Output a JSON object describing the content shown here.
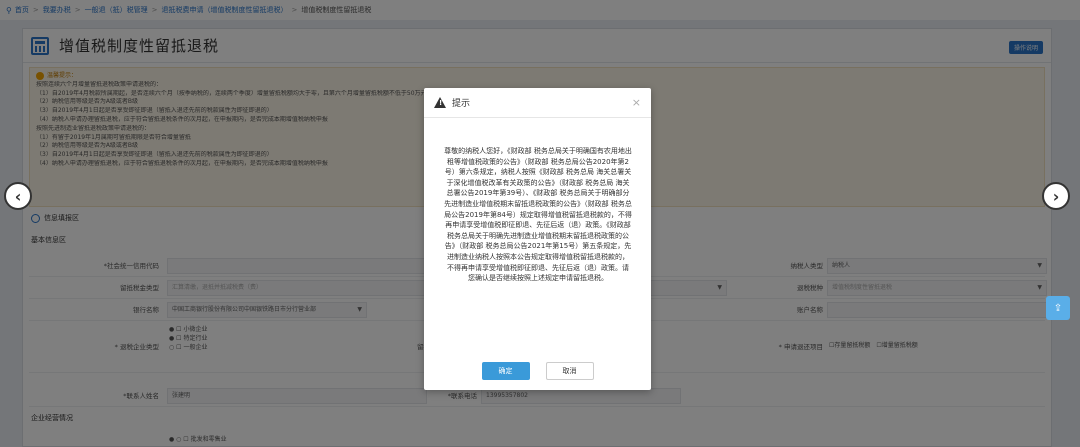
{
  "breadcrumb": {
    "items": [
      "首页",
      "我要办税",
      "一般退（抵）税管理",
      "退抵税费申请（增值税制度性留抵退税）",
      "增值税制度性留抵退税"
    ]
  },
  "panel": {
    "title": "增值税制度性留抵退税",
    "op_guide": "操作说明"
  },
  "tips": {
    "head": "温馨提示：",
    "lines": [
      "按照连续六个月增量留抵退税政策申请退税的：",
      "（1）自2019年4月税款所属期起，是否连续六个月（按季纳税的，连续两个季度）增量留抵税额均大于零，且第六个月增量留抵税额不低于50万元；是否符合纳税信用等级为A级或者B级；增量留抵税额是否符合以上条件",
      "（2）纳税信用等级是否为A级或者B级",
      "（3）自2019年4月1日起是否享受即征即退（留抵入退还先前的税款属性为即征即退的）",
      "（4）纳税人申请办理留抵退税，应于符合留抵退税条件的次月起，在申报期内，是否完成本期增值税纳税申报",
      "按照先进制造业留抵退税政策申请退税的：",
      "（1）有留于2019年1月属期可留抵期限是否符合增量留抵",
      "（2）纳税信用等级是否为A级或者B级",
      "（3）自2019年4月1日起是否享受即征即退（留抵入退还先前的税款属性为即征即退的）",
      "（4）纳税人申请办理留抵退税，应于符合留抵退税条件的次月起，在申报期内，是否完成本期增值税纳税申报"
    ]
  },
  "sections": {
    "info_title": "信息填报区",
    "basic_title": "基本信息区",
    "ops_title": "企业经营情况"
  },
  "form": {
    "credit_code_label": "*社会统一信用代码",
    "refund_type_label": "留抵税金类型",
    "refund_type_value": "汇算清缴，退抵并抵减税费（费）",
    "bank_label": "银行名称",
    "bank_value": "中国工商银行股份有限公司中国银铁路日市分行营业部",
    "enterprise_type_label": "* 退税企业类型",
    "enterprise_type_opts": [
      "小微企业",
      "特定行业",
      "一般企业"
    ],
    "middle_label": "留抵退税",
    "contact_label": "*联系人姓名",
    "contact_value": "张建明",
    "phone_label": "*联系电话",
    "phone_value": "13995357802",
    "taxpayer_type_label": "纳税人类型",
    "taxpayer_type_value": "纳税人",
    "refund_item_label": "退税税种",
    "refund_item_value": "增值税制度性留抵退税",
    "account_label": "账户名称",
    "apply_item_label": "* 申请退还项目",
    "apply_opt1": "存量留抵税额",
    "apply_opt2": "增量留抵税额",
    "ops_opt": "批发和零售业"
  },
  "dialog": {
    "title": "提示",
    "body": "尊敬的纳税人您好，《财政部 税务总局关于明确国有农用地出租等增值税政策的公告》（财政部 税务总局公告2020年第2号）第六条规定，纳税人按照《财政部 税务总局 海关总署关于深化增值税改革有关政策的公告》（财政部 税务总局 海关总署公告2019年第39号）、《财政部 税务总局关于明确部分先进制造业增值税期末留抵退税政策的公告》（财政部 税务总局公告2019年第84号）规定取得增值税留抵退税款的，不得再申请享受增值税即征即退、先征后返（退）政策。《财政部 税务总局关于明确先进制造业增值税期末留抵退税政策的公告》（财政部 税务总局公告2021年第15号）第五条规定，先进制造业纳税人按照本公告规定取得增值税留抵退税款的，不得再申请享受增值税即征即退、先征后返（退）政策。请您确认是否继续按照上述规定申请留抵退税。",
    "ok_label": "确定",
    "cancel_label": "取消"
  }
}
